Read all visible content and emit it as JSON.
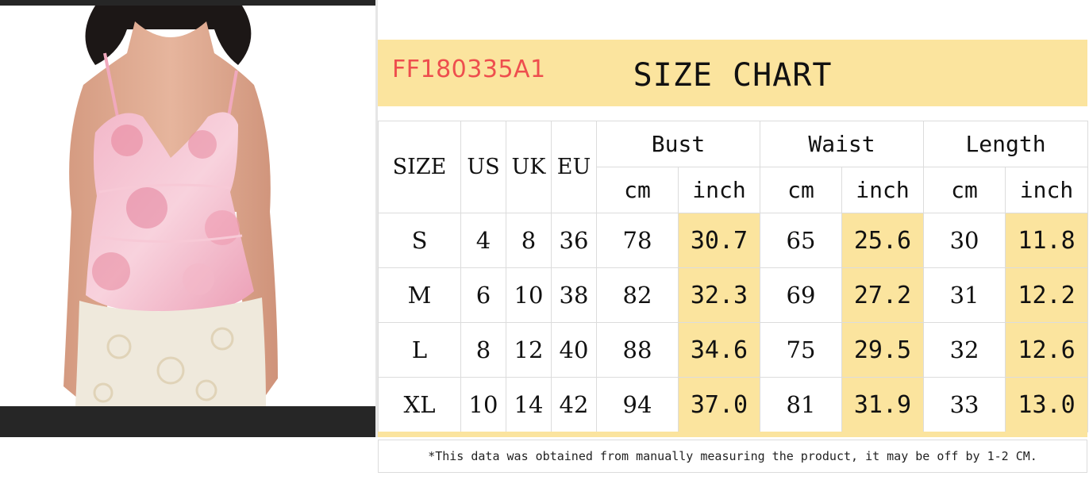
{
  "chart": {
    "sku": "FF180335A1",
    "title": "SIZE CHART",
    "header": {
      "size": "SIZE",
      "us": "US",
      "uk": "UK",
      "eu": "EU",
      "groups": [
        "Bust",
        "Waist",
        "Length"
      ],
      "units": [
        "cm",
        "inch",
        "cm",
        "inch",
        "cm",
        "inch"
      ]
    },
    "rows": [
      {
        "size": "S",
        "us": "4",
        "uk": "8",
        "eu": "36",
        "bust_cm": "78",
        "bust_in": "30.7",
        "waist_cm": "65",
        "waist_in": "25.6",
        "length_cm": "30",
        "length_in": "11.8"
      },
      {
        "size": "M",
        "us": "6",
        "uk": "10",
        "eu": "38",
        "bust_cm": "82",
        "bust_in": "32.3",
        "waist_cm": "69",
        "waist_in": "27.2",
        "length_cm": "31",
        "length_in": "12.2"
      },
      {
        "size": "L",
        "us": "8",
        "uk": "12",
        "eu": "40",
        "bust_cm": "88",
        "bust_in": "34.6",
        "waist_cm": "75",
        "waist_in": "29.5",
        "length_cm": "32",
        "length_in": "12.6"
      },
      {
        "size": "XL",
        "us": "10",
        "uk": "14",
        "eu": "42",
        "bust_cm": "94",
        "bust_in": "37.0",
        "waist_cm": "81",
        "waist_in": "31.9",
        "length_cm": "33",
        "length_in": "13.0"
      }
    ],
    "note": "*This data was obtained from manually measuring the product, it may be off by 1-2 CM."
  },
  "colors": {
    "highlight": "#fbe49e",
    "sku": "#ee4e4e",
    "border": "#dcdcdc",
    "frame": "#262626"
  }
}
